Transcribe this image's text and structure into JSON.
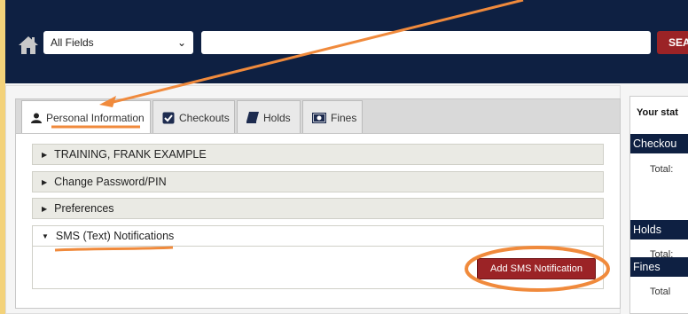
{
  "header": {
    "field_select_value": "All Fields",
    "search_value": "",
    "search_button_label": "SEA"
  },
  "tabs": [
    {
      "label": "Personal Information",
      "active": true,
      "icon": "person-icon"
    },
    {
      "label": "Checkouts",
      "active": false,
      "icon": "checkbox-icon"
    },
    {
      "label": "Holds",
      "active": false,
      "icon": "book-icon"
    },
    {
      "label": "Fines",
      "active": false,
      "icon": "money-icon"
    }
  ],
  "accordion": [
    {
      "label": "TRAINING, FRANK EXAMPLE",
      "open": false
    },
    {
      "label": "Change Password/PIN",
      "open": false
    },
    {
      "label": "Preferences",
      "open": false
    },
    {
      "label": "SMS (Text) Notifications",
      "open": true
    }
  ],
  "sms": {
    "add_button_label": "Add SMS Notification"
  },
  "status_panel": {
    "title": "Your stat",
    "sections": [
      {
        "heading": "Checkou",
        "total_label": "Total:"
      },
      {
        "heading": "Holds",
        "total_label": "Total:"
      },
      {
        "heading": "Fines",
        "total_label": "Total"
      }
    ]
  },
  "colors": {
    "header_bg": "#0e2042",
    "accent_red": "#9b2326",
    "annotation_orange": "#f08a3c",
    "left_strip": "#f3d27a"
  }
}
